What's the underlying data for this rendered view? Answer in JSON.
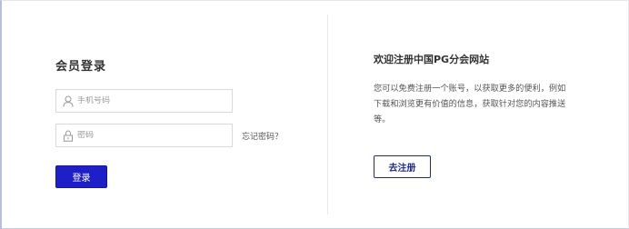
{
  "login": {
    "title": "会员登录",
    "phone_placeholder": "手机号码",
    "password_placeholder": "密码",
    "forgot_label": "忘记密码？",
    "submit_label": "登录"
  },
  "welcome": {
    "title": "欢迎注册中国PG分会网站",
    "description": "您可以免费注册一个账号，以获取更多的便利，例如下载和浏览更有价值的信息，获取针对您的内容推送等。",
    "register_label": "去注册"
  },
  "colors": {
    "accent": "#1f1fc8",
    "register_border": "#1f2a8a"
  },
  "icons": {
    "phone_field": "user-icon",
    "password_field": "lock-icon"
  }
}
